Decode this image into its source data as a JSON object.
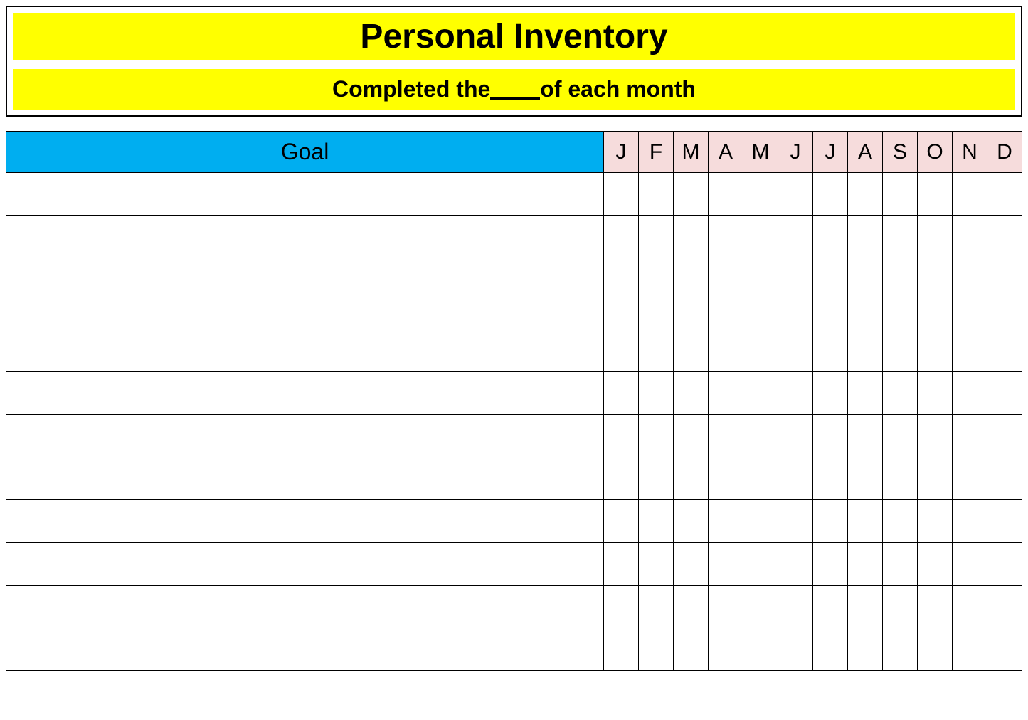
{
  "header": {
    "title": "Personal Inventory",
    "subtitle_prefix": "Completed the",
    "subtitle_suffix": "of each month"
  },
  "table": {
    "goal_header": "Goal",
    "months": [
      "J",
      "F",
      "M",
      "A",
      "M",
      "J",
      "J",
      "A",
      "S",
      "O",
      "N",
      "D"
    ],
    "rows": [
      {
        "goal": "",
        "months": [
          "",
          "",
          "",
          "",
          "",
          "",
          "",
          "",
          "",
          "",
          "",
          ""
        ],
        "tall": false
      },
      {
        "goal": "",
        "months": [
          "",
          "",
          "",
          "",
          "",
          "",
          "",
          "",
          "",
          "",
          "",
          ""
        ],
        "tall": true
      },
      {
        "goal": "",
        "months": [
          "",
          "",
          "",
          "",
          "",
          "",
          "",
          "",
          "",
          "",
          "",
          ""
        ],
        "tall": false
      },
      {
        "goal": "",
        "months": [
          "",
          "",
          "",
          "",
          "",
          "",
          "",
          "",
          "",
          "",
          "",
          ""
        ],
        "tall": false
      },
      {
        "goal": "",
        "months": [
          "",
          "",
          "",
          "",
          "",
          "",
          "",
          "",
          "",
          "",
          "",
          ""
        ],
        "tall": false
      },
      {
        "goal": "",
        "months": [
          "",
          "",
          "",
          "",
          "",
          "",
          "",
          "",
          "",
          "",
          "",
          ""
        ],
        "tall": false
      },
      {
        "goal": "",
        "months": [
          "",
          "",
          "",
          "",
          "",
          "",
          "",
          "",
          "",
          "",
          "",
          ""
        ],
        "tall": false
      },
      {
        "goal": "",
        "months": [
          "",
          "",
          "",
          "",
          "",
          "",
          "",
          "",
          "",
          "",
          "",
          ""
        ],
        "tall": false
      },
      {
        "goal": "",
        "months": [
          "",
          "",
          "",
          "",
          "",
          "",
          "",
          "",
          "",
          "",
          "",
          ""
        ],
        "tall": false
      },
      {
        "goal": "",
        "months": [
          "",
          "",
          "",
          "",
          "",
          "",
          "",
          "",
          "",
          "",
          "",
          ""
        ],
        "tall": false
      }
    ]
  }
}
